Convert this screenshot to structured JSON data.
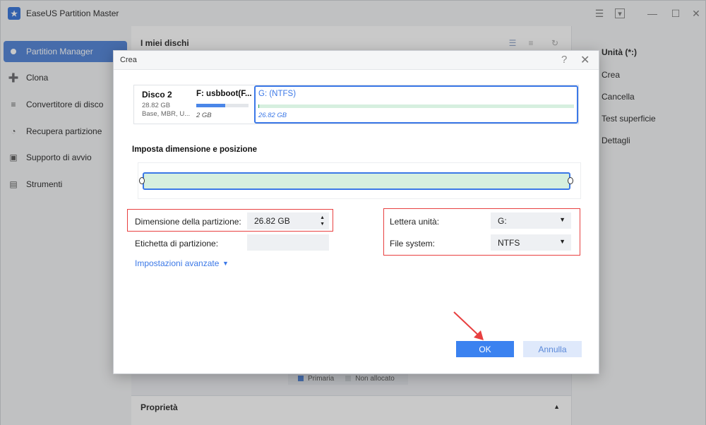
{
  "app": {
    "title": "EaseUS Partition Master",
    "logo_glyph": "★"
  },
  "window_controls": {
    "feedback_icon": "☰",
    "menu_icon": "▾",
    "minimize_icon": "—",
    "maximize_icon": "☐",
    "close_icon": "✕"
  },
  "sidebar": {
    "items": [
      {
        "label": "Partition Manager",
        "icon": "◉"
      },
      {
        "label": "Clona",
        "icon": "➕"
      },
      {
        "label": "Convertitore di disco",
        "icon": "≡"
      },
      {
        "label": "Recupera partizione",
        "icon": "◔"
      },
      {
        "label": "Supporto di avvio",
        "icon": "▣"
      },
      {
        "label": "Strumenti",
        "icon": "▤"
      }
    ]
  },
  "main": {
    "title": "I miei dischi",
    "legend": {
      "primary": "Primaria",
      "unallocated": "Non allocato",
      "primary_color": "#4a7fd6",
      "unallocated_color": "#c9cdd3"
    },
    "properties_label": "Proprietà",
    "properties_caret": "▲"
  },
  "right_panel": {
    "title": "Unità (*:)",
    "items": [
      "Crea",
      "Cancella",
      "Test superficie",
      "Dettagli"
    ]
  },
  "dialog": {
    "title": "Crea",
    "help_icon": "?",
    "close_icon": "✕",
    "disk": {
      "name": "Disco 2",
      "size": "28.82 GB",
      "info": "Base, MBR, U..."
    },
    "partition_f": {
      "name": "F: usbboot(F...",
      "size": "2 GB",
      "used_percent": 55
    },
    "partition_g": {
      "name": "G: (NTFS)",
      "size": "26.82 GB",
      "used_percent": 0
    },
    "section_title": "Imposta dimensione e posizione",
    "size_label": "Dimensione della partizione:",
    "size_value": "26.82 GB",
    "label_label": "Etichetta di partizione:",
    "label_value": "",
    "advanced_label": "Impostazioni avanzate",
    "drive_letter_label": "Lettera unità:",
    "drive_letter_value": "G:",
    "filesystem_label": "File system:",
    "filesystem_value": "NTFS",
    "ok_label": "OK",
    "cancel_label": "Annulla"
  },
  "colors": {
    "accent": "#3b78e7",
    "highlight_red": "#e84040",
    "partition_green": "#d6efdf"
  }
}
